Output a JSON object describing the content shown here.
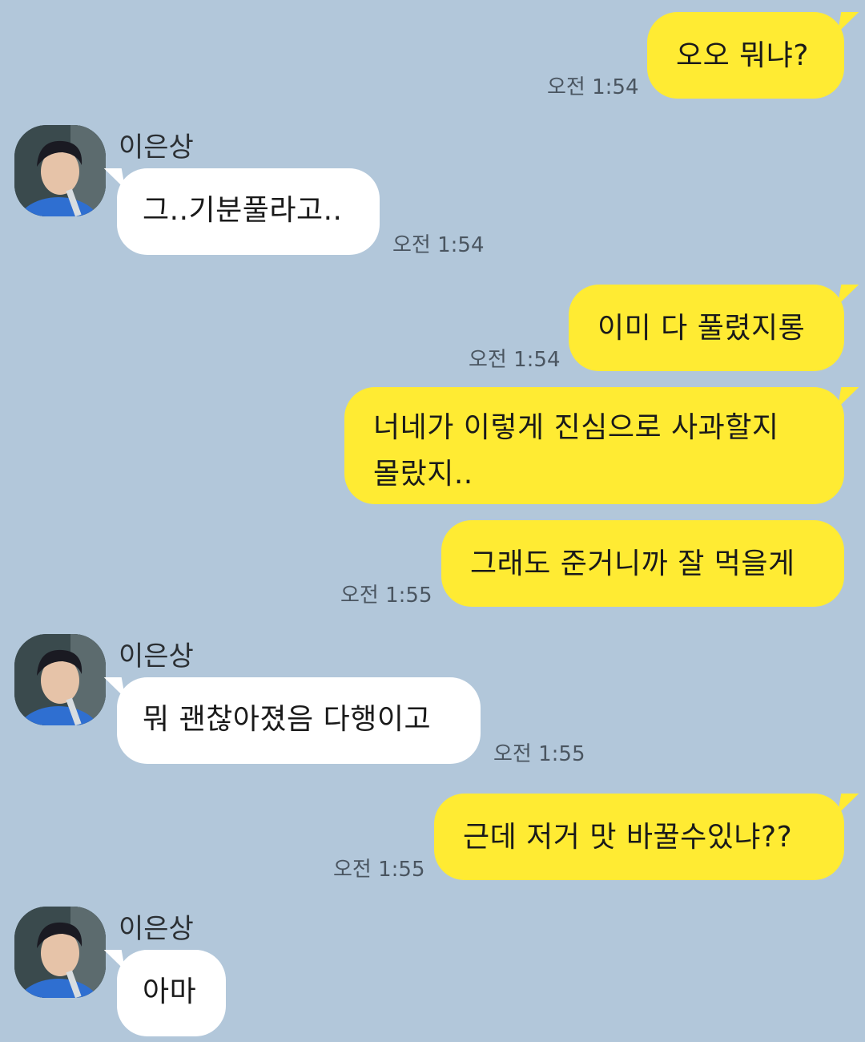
{
  "contact": {
    "name": "이은상"
  },
  "messages": [
    {
      "side": "me",
      "text": "오오 뭐냐?",
      "time": "오전 1:54"
    },
    {
      "side": "them",
      "text": "그..기분풀라고..",
      "time": "오전 1:54"
    },
    {
      "side": "me",
      "text": "이미 다 풀렸지롱",
      "time": "오전 1:54"
    },
    {
      "side": "me",
      "text_line1": "너네가 이렇게 진심으로 사과할지",
      "text_line2": "몰랐지.."
    },
    {
      "side": "me",
      "text": "그래도 준거니까 잘 먹을게",
      "time": "오전 1:55"
    },
    {
      "side": "them",
      "text": "뭐 괜찮아졌음 다행이고",
      "time": "오전 1:55"
    },
    {
      "side": "me",
      "text": "근데 저거 맛 바꿀수있냐??",
      "time": "오전 1:55"
    },
    {
      "side": "them",
      "text": "아마"
    }
  ],
  "colors": {
    "background": "#b2c7da",
    "my_bubble": "#ffeb33",
    "their_bubble": "#ffffff"
  },
  "icons": {
    "avatar": "profile-photo"
  }
}
